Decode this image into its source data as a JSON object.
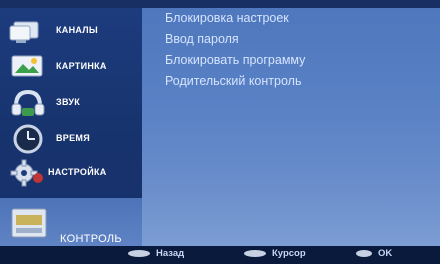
{
  "sidebar": {
    "items": [
      {
        "label": "КАНАЛЫ",
        "icon": "tv-channels-icon"
      },
      {
        "label": "КАРТИНКА",
        "icon": "picture-icon"
      },
      {
        "label": "ЗВУК",
        "icon": "headphones-icon"
      },
      {
        "label": "ВРЕМЯ",
        "icon": "clock-icon"
      },
      {
        "label": "НАСТРОЙКА",
        "icon": "gear-icon"
      },
      {
        "label": "КОНТРОЛЬ",
        "icon": "lock-control-icon"
      }
    ]
  },
  "main": {
    "options": [
      "Блокировка настроек",
      "Ввод пароля",
      "Блокировать программу",
      "Родительский контроль"
    ]
  },
  "bottom": {
    "back_label": "Назад",
    "cursor_label": "Курсор",
    "ok_label": "OK"
  },
  "colors": {
    "sidebar": "#1d3c7e",
    "main": "#5a82c5",
    "active": "#5a7fc0",
    "text": "#d6e4ff"
  }
}
